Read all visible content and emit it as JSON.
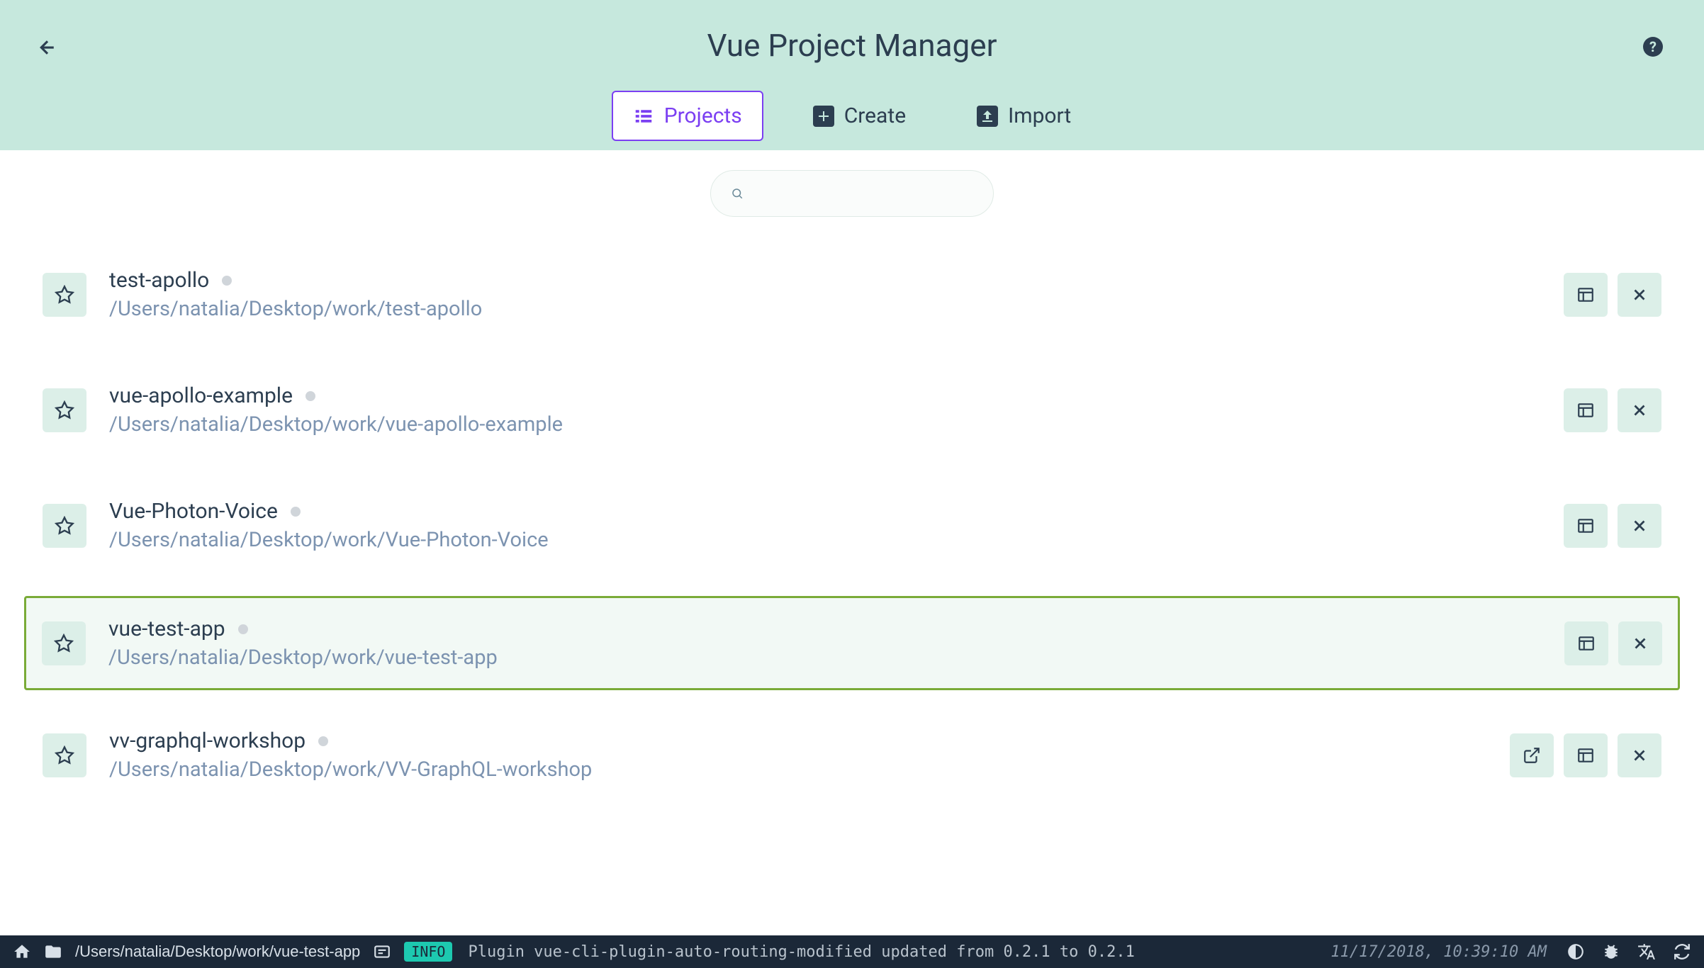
{
  "header": {
    "title": "Vue Project Manager",
    "tabs": [
      {
        "id": "projects",
        "label": "Projects",
        "active": true
      },
      {
        "id": "create",
        "label": "Create",
        "active": false
      },
      {
        "id": "import",
        "label": "Import",
        "active": false
      }
    ]
  },
  "search": {
    "placeholder": ""
  },
  "projects": [
    {
      "name": "test-apollo",
      "path": "/Users/natalia/Desktop/work/test-apollo",
      "highlighted": false,
      "showOpenExternal": false
    },
    {
      "name": "vue-apollo-example",
      "path": "/Users/natalia/Desktop/work/vue-apollo-example",
      "highlighted": false,
      "showOpenExternal": false
    },
    {
      "name": "Vue-Photon-Voice",
      "path": "/Users/natalia/Desktop/work/Vue-Photon-Voice",
      "highlighted": false,
      "showOpenExternal": false
    },
    {
      "name": "vue-test-app",
      "path": "/Users/natalia/Desktop/work/vue-test-app",
      "highlighted": true,
      "showOpenExternal": false
    },
    {
      "name": "vv-graphql-workshop",
      "path": "/Users/natalia/Desktop/work/VV-GraphQL-workshop",
      "highlighted": false,
      "showOpenExternal": true
    }
  ],
  "statusbar": {
    "path": "/Users/natalia/Desktop/work/vue-test-app",
    "badge": "INFO",
    "message": "Plugin vue-cli-plugin-auto-routing-modified updated from 0.2.1 to 0.2.1",
    "timestamp": "11/17/2018, 10:39:10 AM"
  }
}
